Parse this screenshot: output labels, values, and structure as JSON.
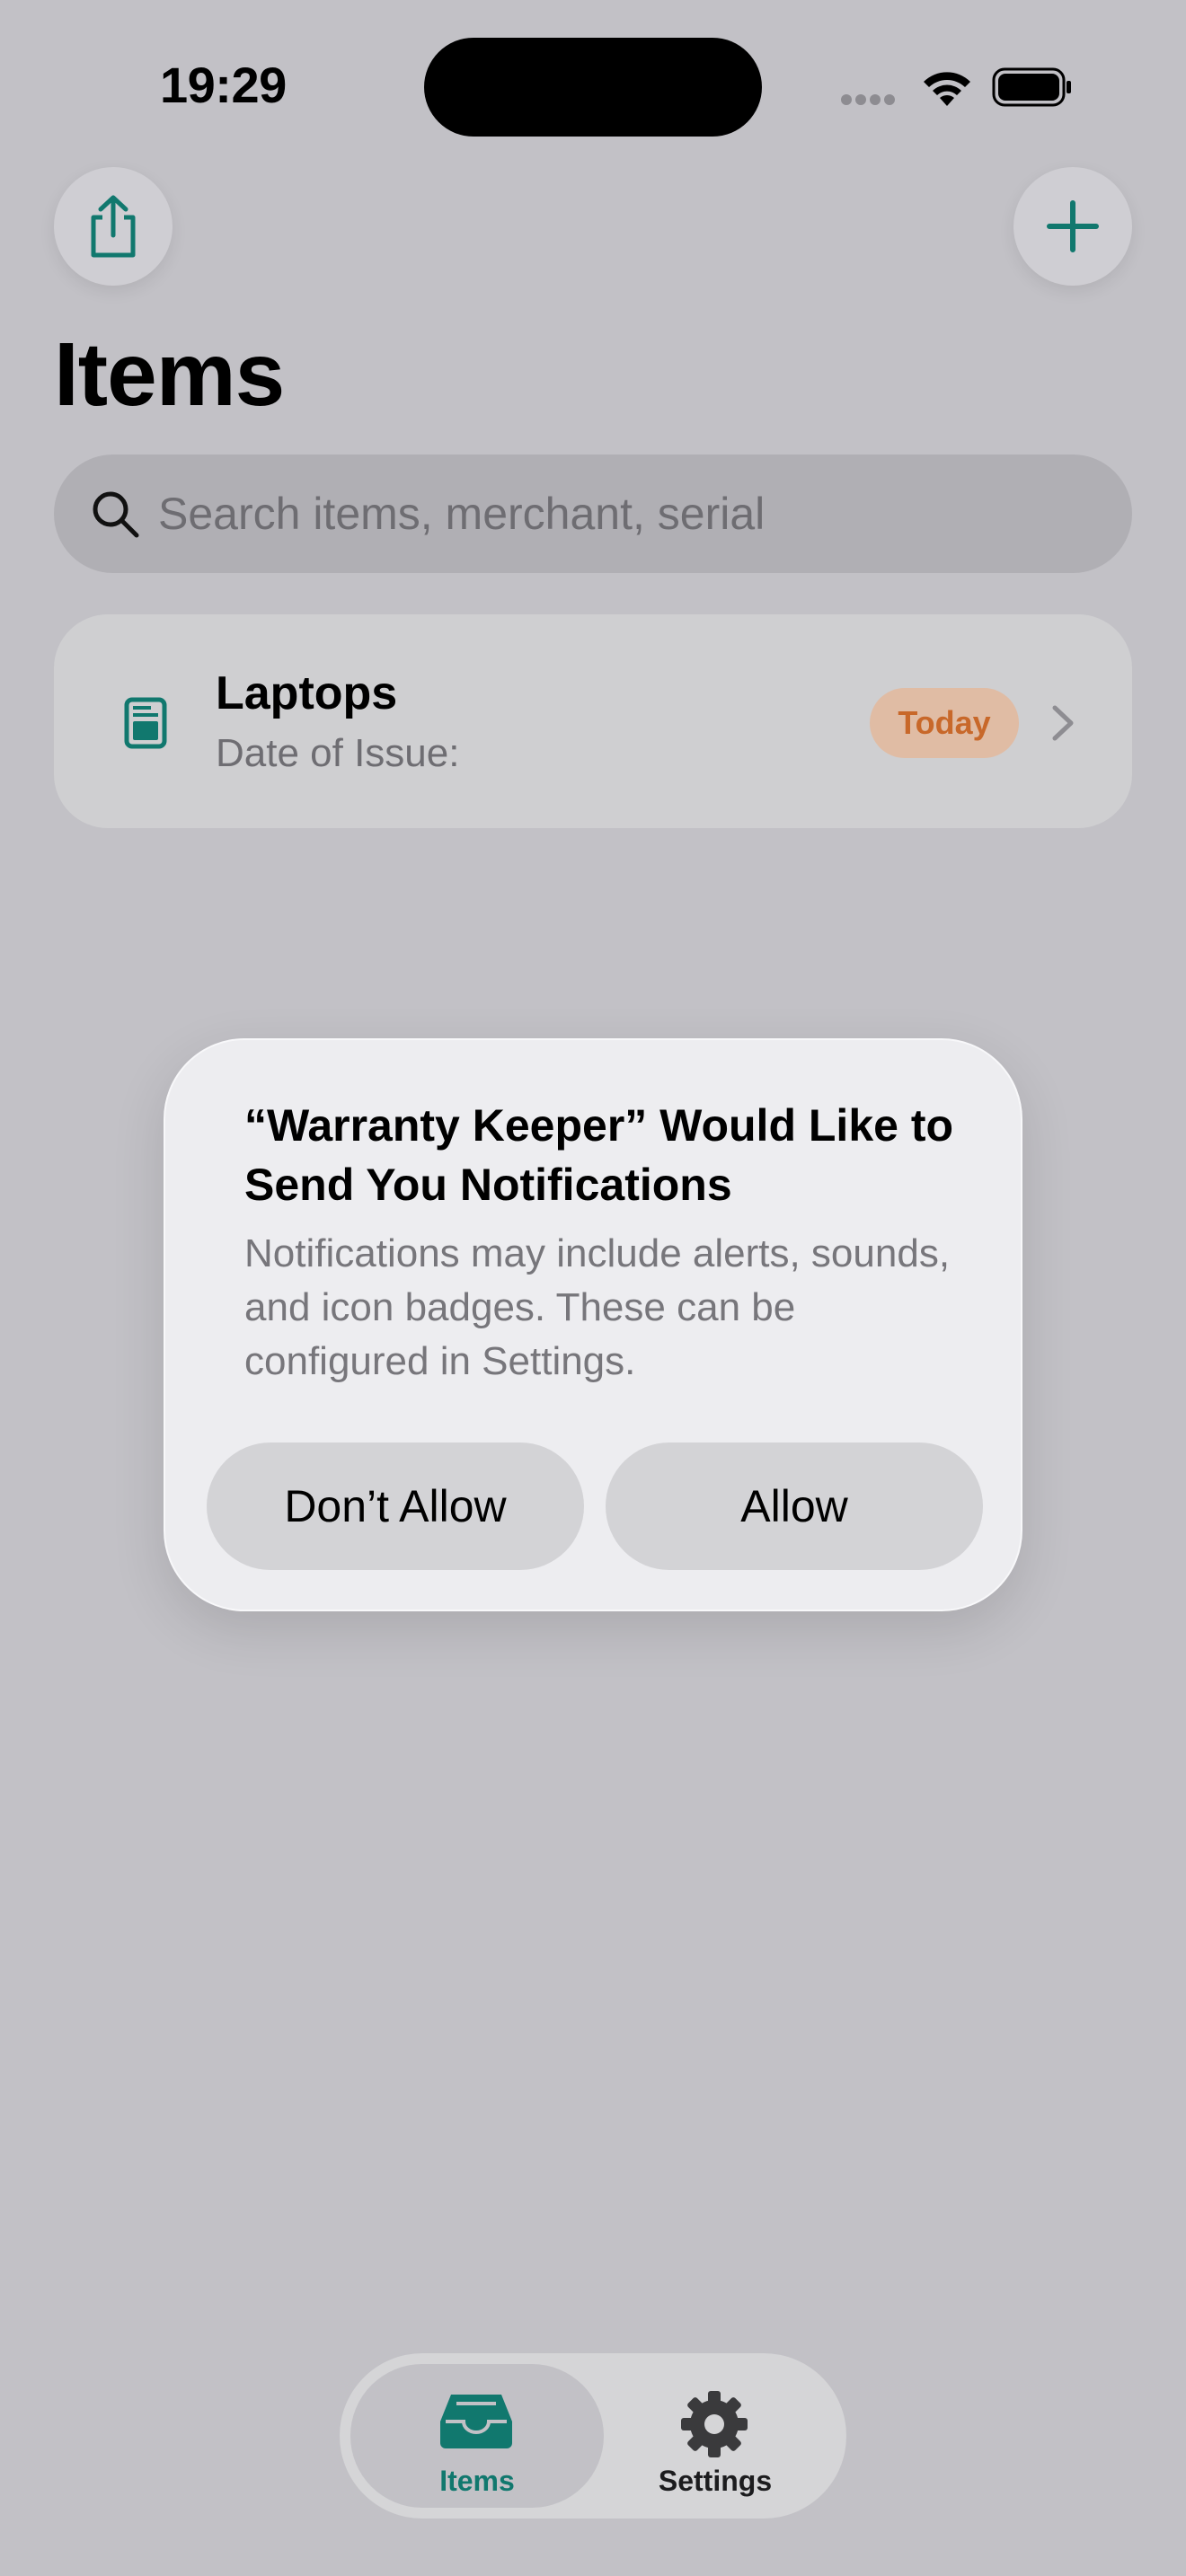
{
  "status_bar": {
    "time": "19:29"
  },
  "header": {
    "title": "Items",
    "share_icon": "share-icon",
    "add_icon": "plus-icon"
  },
  "search": {
    "placeholder": "Search items, merchant, serial"
  },
  "items": [
    {
      "title": "Laptops",
      "subtitle": "Date of Issue:",
      "badge": "Today",
      "icon": "document-icon"
    }
  ],
  "alert": {
    "title": "“Warranty Keeper” Would Like to Send You Notifications",
    "body": "Notifications may include alerts, sounds, and icon badges. These can be configured in Settings.",
    "deny_label": "Don’t Allow",
    "allow_label": "Allow"
  },
  "tabbar": {
    "tabs": [
      {
        "label": "Items",
        "icon": "tray-icon",
        "selected": true
      },
      {
        "label": "Settings",
        "icon": "gear-icon",
        "selected": false
      }
    ]
  },
  "colors": {
    "accent": "#11786e",
    "badge_text": "#c8682a",
    "badge_bg": "#e0bca4",
    "background": "#c2c1c6"
  }
}
